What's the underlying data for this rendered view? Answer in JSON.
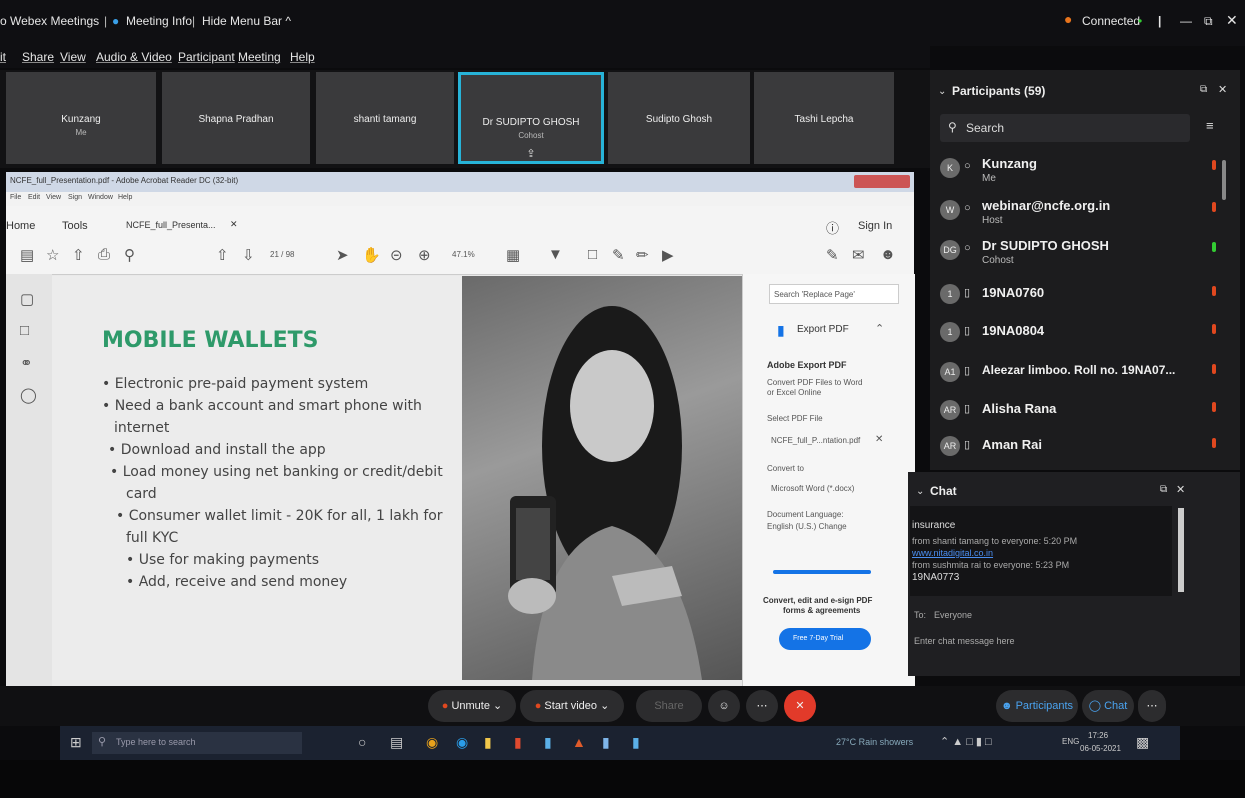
{
  "webex": {
    "title_left": "o Webex Meetings",
    "meeting_info": "Meeting Info",
    "hide_menu": "Hide Menu Bar ^",
    "status": "Connected",
    "menu": [
      "it",
      "Share",
      "View",
      "Audio & Video",
      "Participant",
      "Meeting",
      "Help"
    ]
  },
  "tiles": [
    {
      "name": "Kunzang",
      "sub": "Me"
    },
    {
      "name": "Shapna Pradhan",
      "sub": ""
    },
    {
      "name": "shanti tamang",
      "sub": ""
    },
    {
      "name": "Dr SUDIPTO GHOSH",
      "sub": "Cohost"
    },
    {
      "name": "Sudipto Ghosh",
      "sub": ""
    },
    {
      "name": "Tashi Lepcha",
      "sub": ""
    }
  ],
  "acrobat": {
    "title": "NCFE_full_Presentation.pdf - Adobe Acrobat Reader DC (32-bit)",
    "menu": [
      "File",
      "Edit",
      "View",
      "Sign",
      "Window",
      "Help"
    ],
    "tab_home": "Home",
    "tab_tools": "Tools",
    "tab_doc": "NCFE_full_Presenta...",
    "sign_in": "Sign In",
    "page": "21 / 98",
    "zoom": "47.1%"
  },
  "slide": {
    "title": "MOBILE WALLETS",
    "bullets": [
      "• Electronic pre-paid payment system",
      "• Need a bank account and smart phone with",
      "internet",
      "• Download and install the app",
      "• Load money using net banking or credit/debit",
      "card",
      "• Consumer wallet limit - 20K for all, 1 lakh for",
      "full KYC",
      "• Use for making payments",
      "• Add, receive and send money"
    ]
  },
  "right_pane": {
    "search": "Search 'Replace Page'",
    "export_pdf": "Export PDF",
    "adobe_export": "Adobe Export PDF",
    "convert_desc1": "Convert PDF Files to Word",
    "convert_desc2": "or Excel Online",
    "select_file": "Select PDF File",
    "file_name": "NCFE_full_P...ntation.pdf",
    "convert_to": "Convert to",
    "format": "Microsoft Word (*.docx)",
    "doc_lang": "Document Language:",
    "lang": "English (U.S.) Change",
    "promo1": "Convert, edit and e-sign PDF",
    "promo2": "forms & agreements",
    "trial": "Free 7-Day Trial"
  },
  "participants": {
    "header": "Participants (59)",
    "search": "Search",
    "list": [
      {
        "initials": "K",
        "name": "Kunzang",
        "role": "Me",
        "muted": true
      },
      {
        "initials": "W",
        "name": "webinar@ncfe.org.in",
        "role": "Host",
        "muted": true
      },
      {
        "initials": "DG",
        "name": "Dr SUDIPTO GHOSH",
        "role": "Cohost",
        "muted": false
      },
      {
        "initials": "1",
        "name": "19NA0760",
        "role": "",
        "muted": true
      },
      {
        "initials": "1",
        "name": "19NA0804",
        "role": "",
        "muted": true
      },
      {
        "initials": "A1",
        "name": "Aleezar limboo. Roll no. 19NA07...",
        "role": "",
        "muted": true
      },
      {
        "initials": "AR",
        "name": "Alisha Rana",
        "role": "",
        "muted": true
      },
      {
        "initials": "AR",
        "name": "Aman Rai",
        "role": "",
        "muted": true
      }
    ]
  },
  "chat": {
    "header": "Chat",
    "lines": [
      "insurance",
      "from shanti tamang to everyone:   5:20 PM",
      "www.nitadigital.co.in",
      "from sushmita rai to everyone:   5:23 PM",
      "19NA0773"
    ],
    "to_label": "To:",
    "to_value": "Everyone",
    "placeholder": "Enter chat message here"
  },
  "controls": {
    "unmute": "Unmute",
    "start_video": "Start video",
    "share": "Share",
    "participants": "Participants",
    "chat": "Chat"
  },
  "taskbar": {
    "search": "Type here to search",
    "weather": "27°C Rain showers",
    "lang": "ENG",
    "time": "17:26",
    "date": "06-05-2021"
  }
}
